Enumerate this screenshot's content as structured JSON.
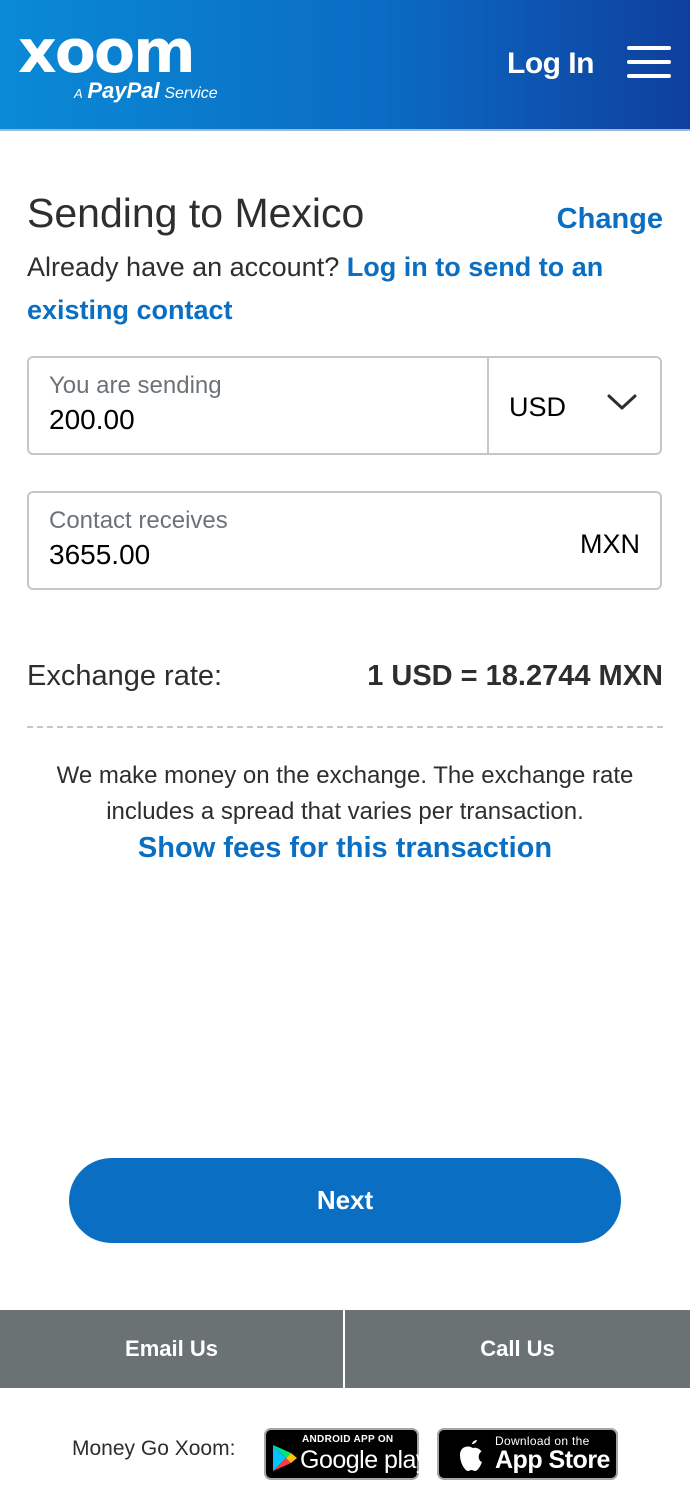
{
  "header": {
    "logo_word": "xoom",
    "logo_a": "A",
    "logo_paypal": "PayPal",
    "logo_service": "Service",
    "login_label": "Log In",
    "menu_icon": "hamburger-menu-icon"
  },
  "main": {
    "title": "Sending to Mexico",
    "change_label": "Change",
    "account_prefix": "Already have an account?",
    "account_link": "Log in to send to an existing contact"
  },
  "sending": {
    "label": "You are sending",
    "value": "200.00",
    "currency": "USD",
    "currency_icon": "chevron-down-icon"
  },
  "receiving": {
    "label": "Contact receives",
    "value": "3655.00",
    "currency": "MXN"
  },
  "exchange": {
    "label": "Exchange rate:",
    "value": "1 USD = 18.2744 MXN",
    "note": "We make money on the exchange. The exchange rate includes a spread that varies per transaction.",
    "fees_link": "Show fees for this transaction"
  },
  "actions": {
    "next_label": "Next"
  },
  "contact": {
    "email_label": "Email Us",
    "call_label": "Call Us"
  },
  "apps": {
    "tagline": "Money Go Xoom:",
    "google_small": "ANDROID APP ON",
    "google_big": "Google play",
    "apple_small": "Download on the",
    "apple_big": "App Store"
  },
  "colors": {
    "brand_blue": "#0a6fc2",
    "footer_gray": "#6b7273"
  }
}
